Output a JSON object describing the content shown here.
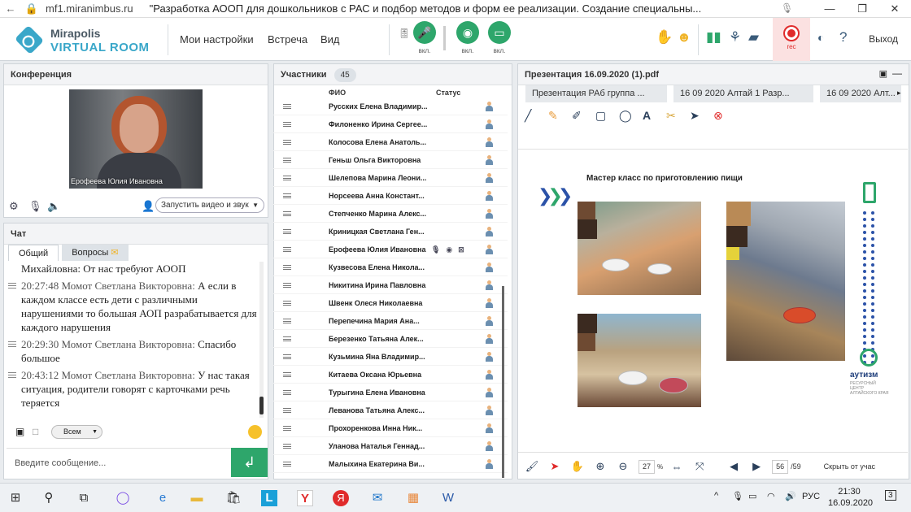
{
  "browser": {
    "url": "mf1.miranimbus.ru",
    "title": "\"Разработка АООП для дошкольников с РАС и подбор методов и форм ее реализации. Создание специальны...",
    "minimize": "—",
    "restore": "❐",
    "close": "✕"
  },
  "app": {
    "logo_line1": "Mirapolis",
    "logo_line2": "VIRTUAL ROOM",
    "menu": [
      "Мои настройки",
      "Встреча",
      "Вид"
    ],
    "mic_label": "вкл.",
    "cam_label": "вкл.",
    "screen_label": "вкл.",
    "rec_label": "rec",
    "exit_label": "Выход",
    "colors": {
      "accent_green": "#2ea66b",
      "brand_blue": "#3aa7c9",
      "rec_red": "#e02b2b"
    }
  },
  "conference": {
    "title": "Конференция",
    "video_caption": "Ерофеева Юлия  Ивановна",
    "start_video_button": "Запустить видео и звук"
  },
  "chat": {
    "title": "Чат",
    "tabs": [
      "Общий",
      "Вопросы"
    ],
    "messages": [
      {
        "time": "",
        "author": "",
        "text": "Михайловна: От нас требуют АООП"
      },
      {
        "time": "20:27:48",
        "author": "Момот Светлана   Викторовна:",
        "text": "А если в каждом классе есть дети с различными нарушениями то большая АОП разрабатывается для каждого нарушения"
      },
      {
        "time": "20:29:30",
        "author": "Момот Светлана   Викторовна:",
        "text": "Спасибо большое"
      },
      {
        "time": "20:43:12",
        "author": "Момот Светлана   Викторовна:",
        "text": "У нас такая ситуация, родители говорят с карточками речь теряется"
      }
    ],
    "recipient": "Всем",
    "input_placeholder": "Введите сообщение...",
    "send_icon": "↲"
  },
  "participants": {
    "title": "Участники",
    "count": "45",
    "col_name": "ФИО",
    "col_status": "Статус",
    "rows": [
      "Русских Елена Владимир...",
      "Филоненко Ирина Сергее...",
      "Колосова Елена  Анатоль...",
      "Геньш Ольга  Викторовна",
      "Шелепова  Марина Леони...",
      "Норсеева Анна  Констант...",
      "Степченко Марина Алекс...",
      "Криницкая Светлана  Ген...",
      "Ерофеева Юлия  Ивановна",
      "Кузвесова Елена  Никола...",
      "Никитина Ирина  Павловна",
      "Швенк  Олеся Николаевна",
      "Перепечина  Мария  Ана...",
      "Березенко  Татьяна Алек...",
      "Кузьмина  Яна  Владимир...",
      "Китаева Оксана  Юрьевна",
      "Турыгина  Елена Ивановна",
      "Леванова Татьяна  Алекс...",
      "Прохоренкова Инна  Ник...",
      "Уланова  Наталья Геннад...",
      "Малыхина  Екатерина  Ви..."
    ]
  },
  "presentation": {
    "title": "Презентация 16.09.2020 (1).pdf",
    "doc_tabs": [
      "Презентация РАб группа ...",
      "16 09 2020 Алтай  1 Разр...",
      "16 09 2020 Алт..."
    ],
    "slide_title": "Мастер класс по приготовлению пищи",
    "brand_name": "аутизм",
    "brand_sub": "РЕСУРСНЫЙ ЦЕНТР АЛТАЙСКОГО КРАЯ",
    "zoom": "27",
    "zoom_unit": "%",
    "page": "56",
    "total_pages": "/59",
    "hide_label": "Скрыть от учас"
  },
  "taskbar": {
    "lang": "РУС",
    "time": "21:30",
    "date": "16.09.2020",
    "notif_count": "3"
  }
}
